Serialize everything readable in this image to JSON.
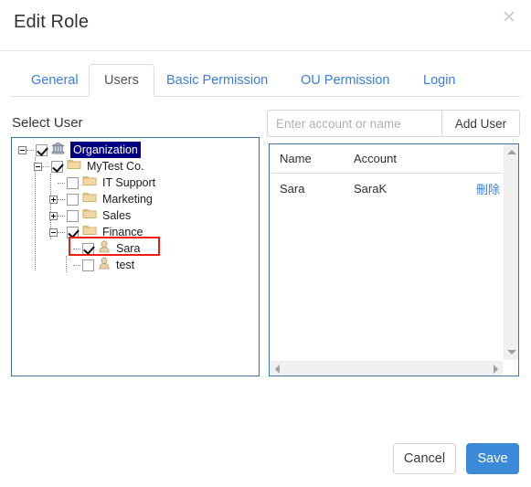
{
  "dialog": {
    "title": "Edit Role",
    "close_icon": "close-icon"
  },
  "tabs": [
    {
      "label": "General",
      "active": false
    },
    {
      "label": "Users",
      "active": true
    },
    {
      "label": "Basic Permission",
      "active": false
    },
    {
      "label": "OU Permission",
      "active": false
    },
    {
      "label": "Login",
      "active": false
    }
  ],
  "left": {
    "section_label": "Select User",
    "tree": [
      {
        "label": "Organization",
        "icon": "bank-icon",
        "checked": true,
        "expander": "minus",
        "selected": true,
        "depth": 0
      },
      {
        "label": "MyTest Co.",
        "icon": "folder-icon",
        "checked": true,
        "expander": "minus",
        "selected": false,
        "depth": 1
      },
      {
        "label": "IT Support",
        "icon": "folder-icon",
        "checked": false,
        "expander": "none",
        "selected": false,
        "depth": 2
      },
      {
        "label": "Marketing",
        "icon": "folder-icon",
        "checked": false,
        "expander": "plus",
        "selected": false,
        "depth": 2
      },
      {
        "label": "Sales",
        "icon": "folder-icon",
        "checked": false,
        "expander": "plus",
        "selected": false,
        "depth": 2
      },
      {
        "label": "Finance",
        "icon": "folder-icon",
        "checked": true,
        "expander": "minus",
        "selected": false,
        "depth": 2
      },
      {
        "label": "Sara",
        "icon": "user-icon",
        "checked": true,
        "expander": "none",
        "selected": false,
        "depth": 3,
        "highlighted": true
      },
      {
        "label": "test",
        "icon": "user-icon",
        "checked": false,
        "expander": "none",
        "selected": false,
        "depth": 3
      }
    ]
  },
  "right": {
    "search_placeholder": "Enter account or name",
    "search_value": "",
    "add_user_label": "Add User",
    "grid": {
      "columns": [
        "Name",
        "Account",
        ""
      ],
      "rows": [
        {
          "name": "Sara",
          "account": "SaraK",
          "action": "刪除"
        }
      ]
    },
    "scrollbar": {
      "up_icon": "triangle-up-icon",
      "down_icon": "triangle-down-icon",
      "left_icon": "triangle-left-icon",
      "right_icon": "triangle-right-icon"
    }
  },
  "footer": {
    "cancel_label": "Cancel",
    "save_label": "Save"
  },
  "colors": {
    "accent": "#3b8ad8",
    "link": "#3b7dd8",
    "panel_border": "#3a76aa",
    "selection": "#000080",
    "highlight": "#ee1c13"
  }
}
